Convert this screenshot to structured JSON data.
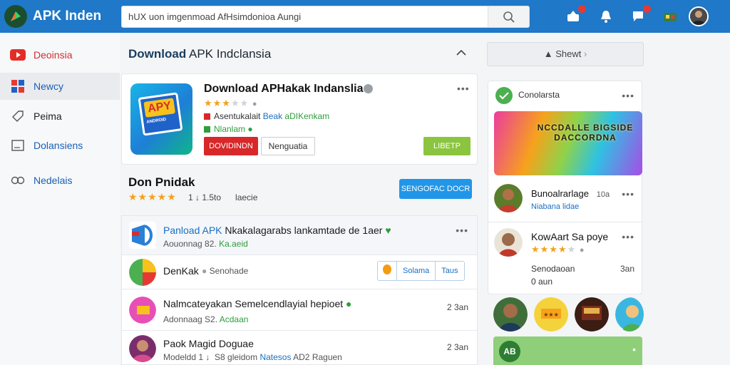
{
  "app": {
    "brand": "APK Inden"
  },
  "search": {
    "value": "hUX uon imgenmoad AfHsimdonioa Aungi"
  },
  "sidebar": {
    "items": [
      {
        "label": "Deoinsia"
      },
      {
        "label": "Newcy"
      },
      {
        "label": "Peima"
      },
      {
        "label": "Dolansiens"
      },
      {
        "label": "Nedelais"
      }
    ]
  },
  "main": {
    "title_bold": "Download",
    "title_rest": " APK Indclansia",
    "app_card": {
      "name": "Download APHakak Indanslia",
      "line1_prefix": "Asentukalait",
      "line1_blue": "Beak",
      "line1_suffix": "aDIKenkam",
      "line2": "Nlanlam",
      "btn_primary": "DOVIDINDN",
      "btn_secondary": "Nenguatia",
      "btn_green": "LIBETP"
    },
    "section": {
      "title": "Don Pnidak",
      "meta1": "1 ↓ 1.5to",
      "meta2": "laecie",
      "button": "SENGOFAC DOCR"
    },
    "list": [
      {
        "title_blue": "Panload APK",
        "title_rest": " Nkakalagarabs lankamtade de 1aer",
        "sub_prefix": "Aouonnag 82.",
        "sub_green": "Ka.aeid",
        "time": ""
      },
      {
        "title": "DenKak",
        "meta": "Senohade",
        "seg1": "Solama",
        "seg2": "Taus"
      },
      {
        "title": "Nalmcateyakan Semelcendlayial hepioet",
        "sub_prefix": "Adonnaag S2.",
        "sub_green": "Acdaan",
        "time": "2 3an"
      },
      {
        "title": "Paok Magid Doguae",
        "sub_prefix": "Modeldd 1 ↓",
        "sub_mid": "S8 gleidom",
        "sub_blue": "Natesos",
        "sub_suffix": "AD2  Raguen",
        "time": "2 3an"
      }
    ]
  },
  "right": {
    "share": "Shewt",
    "card_title": "Conolarsta",
    "banner_text": "NCCDALLE BIGSIDE DACCORDNA",
    "people": [
      {
        "name": "Bunoalrarlage",
        "extra": "10a",
        "sub": "Niabana lidae"
      },
      {
        "name": "KowAart Sa poye",
        "meta": "Senodaoan",
        "meta2": "0 aun",
        "time": "3an"
      }
    ],
    "bottom_label": "AB"
  },
  "colors": {
    "topbar": "#1f78c8",
    "primary_red": "#d8282a",
    "accent_blue": "#2196e8",
    "accent_green": "#8bc53f",
    "star": "#f4a11c"
  }
}
